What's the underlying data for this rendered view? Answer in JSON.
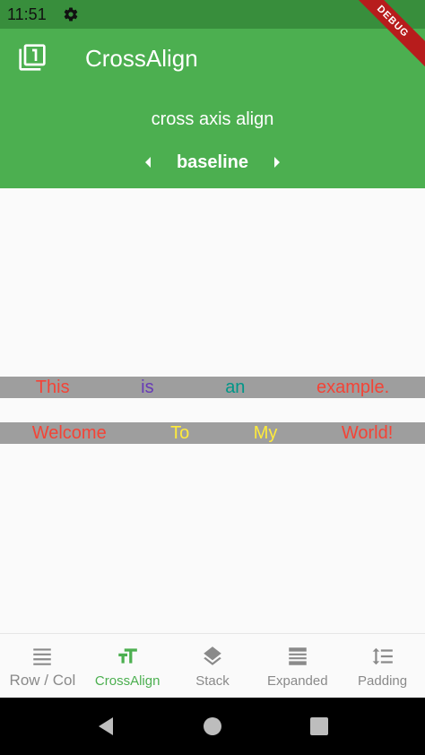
{
  "status_bar": {
    "time": "11:51",
    "settings_icon": "gear-icon"
  },
  "debug_banner": "DEBUG",
  "app_bar": {
    "icon": "filter-1-icon",
    "title": "CrossAlign",
    "axis_label": "cross axis align",
    "selected_value": "baseline",
    "prev_icon": "triangle-left-icon",
    "next_icon": "triangle-right-icon",
    "color": "#4caf50"
  },
  "content": {
    "row1": [
      {
        "text": "This",
        "color": "#f44336"
      },
      {
        "text": "is",
        "color": "#673ab7"
      },
      {
        "text": "an",
        "color": "#009688"
      },
      {
        "text": "example.",
        "color": "#f44336"
      }
    ],
    "row2": [
      {
        "text": "Welcome",
        "color": "#f44336"
      },
      {
        "text": "To",
        "color": "#ffeb3b"
      },
      {
        "text": "My",
        "color": "#ffeb3b"
      },
      {
        "text": "World!",
        "color": "#f44336"
      }
    ],
    "strip_color": "#9e9e9e"
  },
  "bottom_nav": {
    "items": [
      {
        "label": "Row / Col",
        "icon": "lines-icon"
      },
      {
        "label": "CrossAlign",
        "icon": "text-size-icon"
      },
      {
        "label": "Stack",
        "icon": "layers-icon"
      },
      {
        "label": "Expanded",
        "icon": "list-icon"
      },
      {
        "label": "Padding",
        "icon": "line-spacing-icon"
      }
    ],
    "active_index": 1
  },
  "system_nav": {
    "back": "back-icon",
    "home": "home-icon",
    "recents": "recents-icon"
  }
}
